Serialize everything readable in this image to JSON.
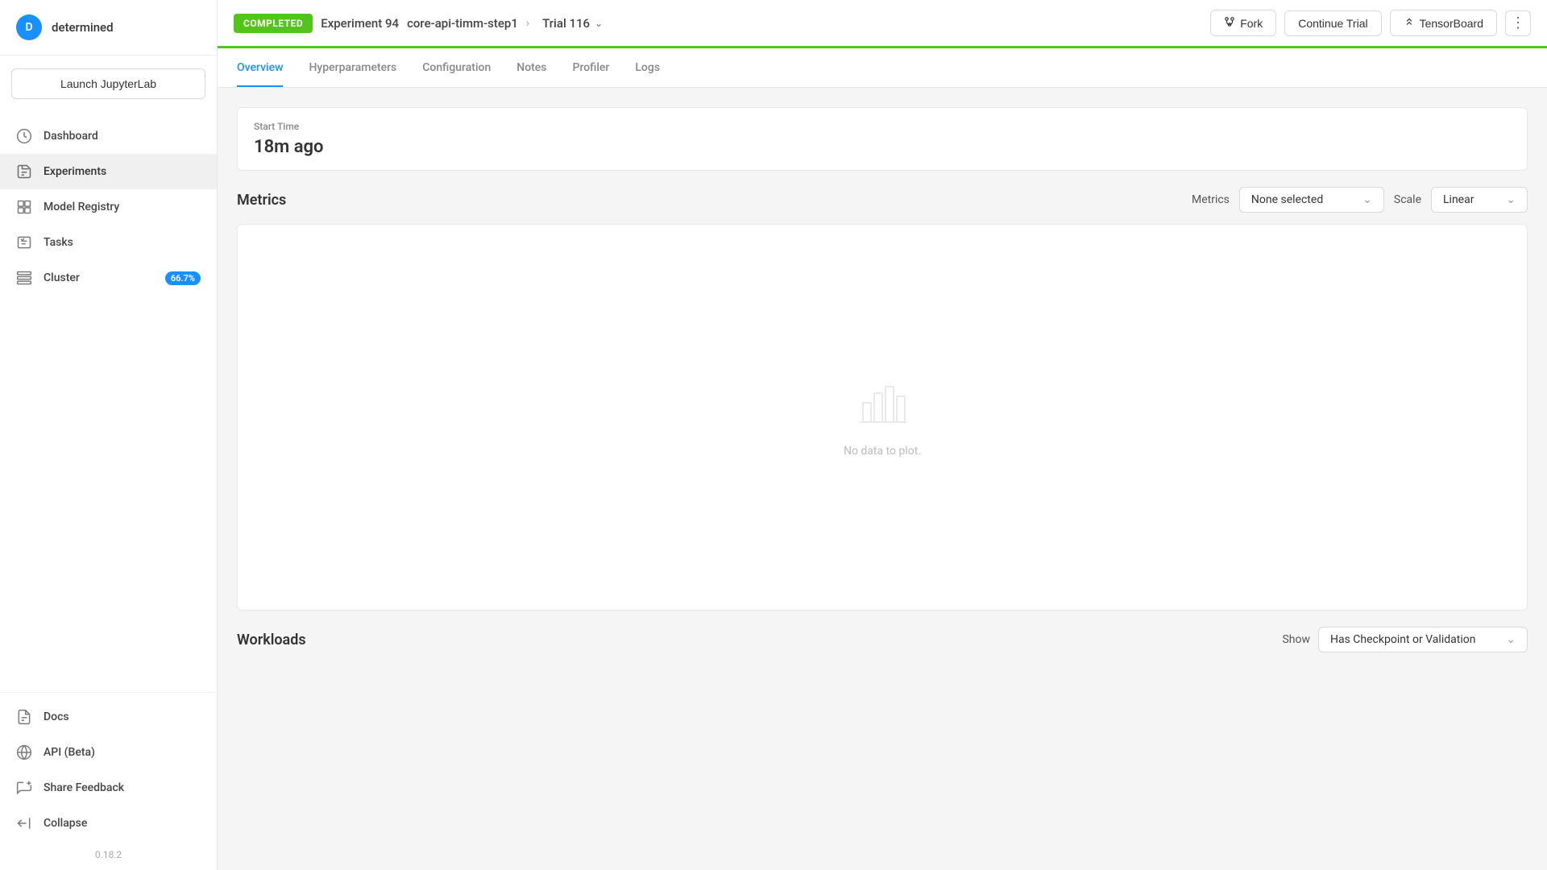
{
  "sidebar": {
    "brand": "determined",
    "avatar_letter": "D",
    "launch_btn_label": "Launch JupyterLab",
    "nav_items": [
      {
        "id": "dashboard",
        "label": "Dashboard",
        "icon": "dashboard-icon",
        "active": false,
        "badge": null
      },
      {
        "id": "experiments",
        "label": "Experiments",
        "icon": "experiments-icon",
        "active": true,
        "badge": null
      },
      {
        "id": "model-registry",
        "label": "Model Registry",
        "icon": "model-registry-icon",
        "active": false,
        "badge": null
      },
      {
        "id": "tasks",
        "label": "Tasks",
        "icon": "tasks-icon",
        "active": false,
        "badge": null
      },
      {
        "id": "cluster",
        "label": "Cluster",
        "icon": "cluster-icon",
        "active": false,
        "badge": "66.7%"
      }
    ],
    "bottom_items": [
      {
        "id": "docs",
        "label": "Docs",
        "icon": "docs-icon"
      },
      {
        "id": "api-beta",
        "label": "API (Beta)",
        "icon": "api-icon"
      },
      {
        "id": "share-feedback",
        "label": "Share Feedback",
        "icon": "feedback-icon"
      },
      {
        "id": "collapse",
        "label": "Collapse",
        "icon": "collapse-icon"
      }
    ],
    "version": "0.18.2"
  },
  "topbar": {
    "status_badge": "COMPLETED",
    "experiment_label": "Experiment 94",
    "experiment_name": "core-api-timm-step1",
    "trial_label": "Trial 116",
    "fork_btn": "Fork",
    "continue_trial_btn": "Continue Trial",
    "tensorboard_btn": "TensorBoard"
  },
  "tabs": {
    "items": [
      {
        "id": "overview",
        "label": "Overview",
        "active": true
      },
      {
        "id": "hyperparameters",
        "label": "Hyperparameters",
        "active": false
      },
      {
        "id": "configuration",
        "label": "Configuration",
        "active": false
      },
      {
        "id": "notes",
        "label": "Notes",
        "active": false
      },
      {
        "id": "profiler",
        "label": "Profiler",
        "active": false
      },
      {
        "id": "logs",
        "label": "Logs",
        "active": false
      }
    ]
  },
  "overview": {
    "start_time_label": "Start Time",
    "start_time_value": "18m ago",
    "metrics_section_title": "Metrics",
    "metrics_label": "Metrics",
    "metrics_placeholder": "None selected",
    "scale_label": "Scale",
    "scale_value": "Linear",
    "no_data_text": "No data to plot.",
    "workloads_section_title": "Workloads",
    "workloads_show_label": "Show",
    "workloads_show_value": "Has Checkpoint or Validation"
  }
}
